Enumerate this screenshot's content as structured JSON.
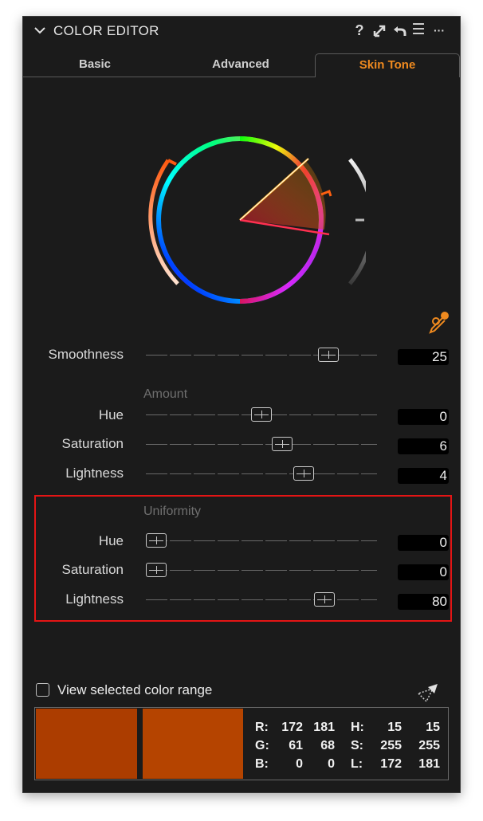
{
  "header": {
    "title": "COLOR EDITOR",
    "help_icon": "?",
    "menu_icon": "☰",
    "more_icon": "···"
  },
  "tabs": [
    {
      "label": "Basic",
      "active": false
    },
    {
      "label": "Advanced",
      "active": false
    },
    {
      "label": "Skin Tone",
      "active": true
    }
  ],
  "colors": {
    "accent": "#ef8a1f",
    "highlight_box": "#e41515",
    "swatch_left": "#ac3d00",
    "swatch_right": "#b54400"
  },
  "smoothness": {
    "label": "Smoothness",
    "value": "25",
    "level": 0.82
  },
  "amount": {
    "title": "Amount",
    "rows": [
      {
        "label": "Hue",
        "value": "0",
        "level": 0.5
      },
      {
        "label": "Saturation",
        "value": "6",
        "level": 0.6
      },
      {
        "label": "Lightness",
        "value": "4",
        "level": 0.7
      }
    ]
  },
  "uniformity": {
    "title": "Uniformity",
    "rows": [
      {
        "label": "Hue",
        "value": "0",
        "level": 0.0
      },
      {
        "label": "Saturation",
        "value": "0",
        "level": 0.0
      },
      {
        "label": "Lightness",
        "value": "80",
        "level": 0.8
      }
    ]
  },
  "view_range": {
    "label": "View selected color range",
    "checked": false
  },
  "readout": {
    "r": {
      "key": "R:",
      "a": "172",
      "b": "181"
    },
    "g": {
      "key": "G:",
      "a": "61",
      "b": "68"
    },
    "b": {
      "key": "B:",
      "a": "0",
      "b": "0"
    },
    "h": {
      "key": "H:",
      "a": "15",
      "b": "15"
    },
    "s": {
      "key": "S:",
      "a": "255",
      "b": "255"
    },
    "l": {
      "key": "L:",
      "a": "172",
      "b": "181"
    }
  }
}
